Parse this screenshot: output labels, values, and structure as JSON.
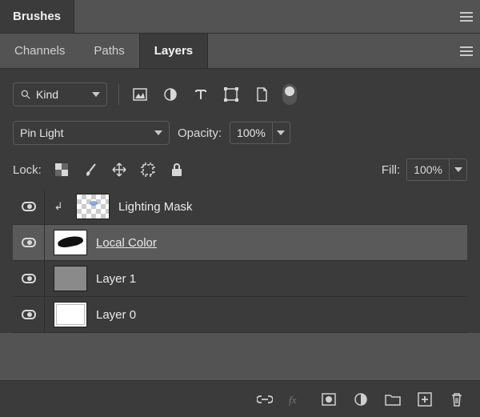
{
  "topPanel": {
    "title": "Brushes"
  },
  "tabs": {
    "items": [
      {
        "label": "Channels",
        "active": false
      },
      {
        "label": "Paths",
        "active": false
      },
      {
        "label": "Layers",
        "active": true
      }
    ]
  },
  "filterRow": {
    "kindLabel": "Kind"
  },
  "blendRow": {
    "mode": "Pin Light",
    "opacityLabel": "Opacity:",
    "opacityValue": "100%"
  },
  "lockRow": {
    "label": "Lock:",
    "fillLabel": "Fill:",
    "fillValue": "100%"
  },
  "layers": [
    {
      "name": "Lighting Mask",
      "clipped": true,
      "selected": false,
      "thumb": "checker",
      "underline": false
    },
    {
      "name": "Local Color",
      "clipped": false,
      "selected": true,
      "thumb": "stroke",
      "underline": true
    },
    {
      "name": "Layer 1",
      "clipped": false,
      "selected": false,
      "thumb": "grey",
      "underline": false
    },
    {
      "name": "Layer 0",
      "clipped": false,
      "selected": false,
      "thumb": "white",
      "underline": false
    }
  ]
}
